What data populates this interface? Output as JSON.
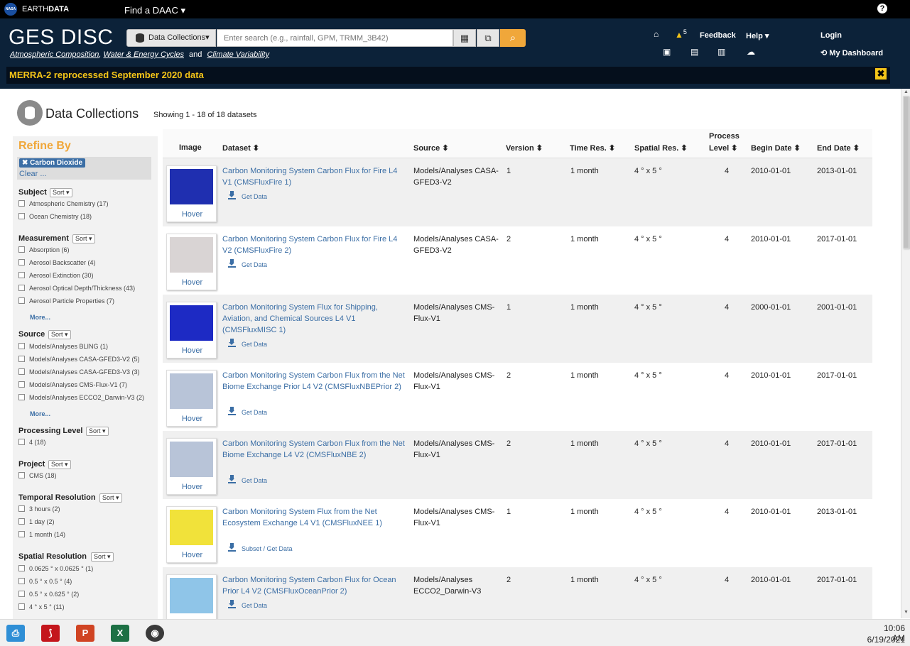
{
  "topbar": {
    "brand_a": "EARTH",
    "brand_b": "DATA",
    "nasa_logo": "NASA",
    "find_daac": "Find a DAAC ▾",
    "help_icon": "?"
  },
  "header": {
    "title": "GES DISC",
    "sub1": "Atmospheric Composition",
    "sub_comma": ",",
    "sub2": "Water & Energy Cycles",
    "sub_and": "and",
    "sub3": "Climate Variability",
    "dc_label": "Data Collections▾",
    "search_placeholder": "Enter search (e.g., rainfall, GPM, TRMM_3B42)",
    "alerts_count": "5",
    "feedback": "Feedback",
    "help": "Help ▾",
    "login": "Login",
    "dashboard": "My Dashboard"
  },
  "banner": {
    "text": "MERRA-2 reprocessed September 2020 data",
    "close": "✖"
  },
  "title": {
    "label": "Data Collections",
    "showing": "Showing 1 - 18 of 18 datasets"
  },
  "sidebar": {
    "refine": "Refine By",
    "chip": "✖ Carbon Dioxide",
    "clear": "Clear ...",
    "sort": "Sort ▾",
    "more": "More...",
    "groups": {
      "subject": {
        "title": "Subject",
        "opts": [
          "Atmospheric Chemistry (17)",
          "Ocean Chemistry (18)"
        ]
      },
      "measurement": {
        "title": "Measurement",
        "opts": [
          "Absorption (6)",
          "Aerosol Backscatter (4)",
          "Aerosol Extinction (30)",
          "Aerosol Optical Depth/Thickness (43)",
          "Aerosol Particle Properties (7)"
        ]
      },
      "source": {
        "title": "Source",
        "opts": [
          "Models/Analyses BLING (1)",
          "Models/Analyses CASA-GFED3-V2 (5)",
          "Models/Analyses CASA-GFED3-V3 (3)",
          "Models/Analyses CMS-Flux-V1 (7)",
          "Models/Analyses ECCO2_Darwin-V3 (2)"
        ]
      },
      "processing": {
        "title": "Processing Level",
        "opts": [
          "4 (18)"
        ]
      },
      "project": {
        "title": "Project",
        "opts": [
          "CMS (18)"
        ]
      },
      "temporal": {
        "title": "Temporal Resolution",
        "opts": [
          "3 hours (2)",
          "1 day (2)",
          "1 month (14)"
        ]
      },
      "spatial": {
        "title": "Spatial Resolution",
        "opts": [
          "0.0625 ° x 0.0625 ° (1)",
          "0.5 ° x 0.5 ° (4)",
          "0.5 ° x 0.625 ° (2)",
          "4 ° x 5 ° (11)"
        ]
      }
    }
  },
  "table": {
    "headers": {
      "image": "Image",
      "dataset": "Dataset ⬍",
      "source": "Source ⬍",
      "version": "Version ⬍",
      "time": "Time Res. ⬍",
      "spatial": "Spatial Res. ⬍",
      "process1": "Process",
      "process2": "Level ⬍",
      "begin": "Begin Date ⬍",
      "end": "End Date ⬍"
    },
    "hover": "Hover",
    "rows": [
      {
        "dataset": "Carbon Monitoring System Carbon Flux for Fire L4 V1 (CMSFluxFire 1)",
        "action": "Get Data",
        "source": "Models/Analyses CASA-GFED3-V2",
        "version": "1",
        "time": "1 month",
        "spatial": "4 ° x 5 °",
        "level": "4",
        "begin": "2010-01-01",
        "end": "2013-01-01",
        "thumb_color": "#1f2fb0"
      },
      {
        "dataset": "Carbon Monitoring System Carbon Flux for Fire L4 V2 (CMSFluxFire 2)",
        "action": "Get Data",
        "source": "Models/Analyses CASA-GFED3-V2",
        "version": "2",
        "time": "1 month",
        "spatial": "4 ° x 5 °",
        "level": "4",
        "begin": "2010-01-01",
        "end": "2017-01-01",
        "thumb_color": "#d9d4d4"
      },
      {
        "dataset": "Carbon Monitoring System Flux for Shipping, Aviation, and Chemical Sources L4 V1 (CMSFluxMISC 1)",
        "action": "Get Data",
        "source": "Models/Analyses CMS-Flux-V1",
        "version": "1",
        "time": "1 month",
        "spatial": "4 ° x 5 °",
        "level": "4",
        "begin": "2000-01-01",
        "end": "2001-01-01",
        "thumb_color": "#1d2ac4"
      },
      {
        "dataset": "Carbon Monitoring System Carbon Flux from the Net Biome Exchange Prior L4 V2 (CMSFluxNBEPrior 2)",
        "action": "Get Data",
        "source": "Models/Analyses CMS-Flux-V1",
        "version": "2",
        "time": "1 month",
        "spatial": "4 ° x 5 °",
        "level": "4",
        "begin": "2010-01-01",
        "end": "2017-01-01",
        "thumb_color": "#b8c4d8"
      },
      {
        "dataset": "Carbon Monitoring System Carbon Flux from the Net Biome Exchange L4 V2 (CMSFluxNBE 2)",
        "action": "Get Data",
        "source": "Models/Analyses CMS-Flux-V1",
        "version": "2",
        "time": "1 month",
        "spatial": "4 ° x 5 °",
        "level": "4",
        "begin": "2010-01-01",
        "end": "2017-01-01",
        "thumb_color": "#b8c4d8"
      },
      {
        "dataset": "Carbon Monitoring System Flux from the Net Ecosystem Exchange L4 V1 (CMSFluxNEE 1)",
        "action": "Subset / Get Data",
        "source": "Models/Analyses CMS-Flux-V1",
        "version": "1",
        "time": "1 month",
        "spatial": "4 ° x 5 °",
        "level": "4",
        "begin": "2010-01-01",
        "end": "2013-01-01",
        "thumb_color": "#f1e23a"
      },
      {
        "dataset": "Carbon Monitoring System Carbon Flux for Ocean Prior L4 V2 (CMSFluxOceanPrior 2)",
        "action": "Get Data",
        "source": "Models/Analyses ECCO2_Darwin-V3",
        "version": "2",
        "time": "1 month",
        "spatial": "4 ° x 5 °",
        "level": "4",
        "begin": "2010-01-01",
        "end": "2017-01-01",
        "thumb_color": "#8fc5e8"
      }
    ]
  },
  "taskbar": {
    "time": "10:06 AM",
    "date": "6/19/2021",
    "apps": [
      "app-icon",
      "P",
      "X",
      "◉"
    ]
  },
  "colors": {
    "accent": "#f0a73a",
    "link": "#3b6ea5",
    "header_bg": "#0c2239",
    "banner_text": "#f5c518"
  }
}
